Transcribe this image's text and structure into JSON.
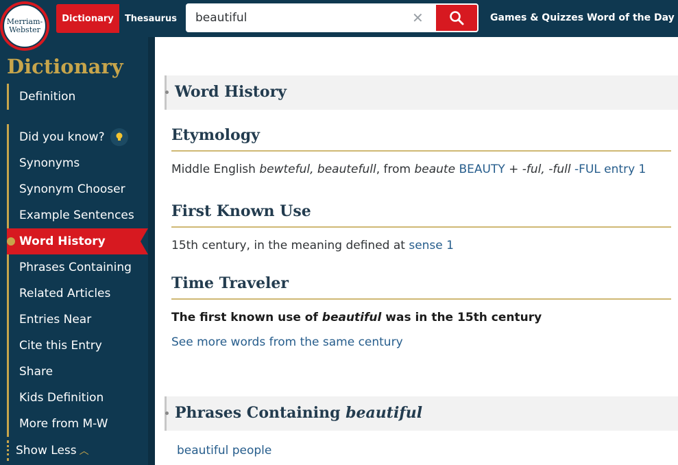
{
  "header": {
    "logo_line1": "Merriam-",
    "logo_line2": "Webster",
    "tab_dictionary": "Dictionary",
    "tab_thesaurus": "Thesaurus",
    "search_value": "beautiful",
    "nav_games": "Games & Quizzes",
    "nav_wotd": "Word of the Day",
    "colors": {
      "navy": "#0f3850",
      "red": "#d71920",
      "gold": "#c7a54b"
    }
  },
  "sidebar": {
    "title": "Dictionary",
    "items": [
      "Definition",
      "Did you know?",
      "Synonyms",
      "Synonym Chooser",
      "Example Sentences",
      "Word History",
      "Phrases Containing",
      "Related Articles",
      "Entries Near",
      "Cite this Entry",
      "Share",
      "Kids Definition",
      "More from M-W"
    ],
    "active": "Word History",
    "show_less": "Show Less"
  },
  "main": {
    "word_history": {
      "title": "Word History",
      "etymology": {
        "heading": "Etymology",
        "t1": "Middle English ",
        "t2": "bewteful, beautefull",
        "t3": ", from ",
        "t4": "beaute",
        "t5": " ",
        "link1": "BEAUTY",
        "t6": " + ",
        "t7": "-ful, -full",
        "t8": " ",
        "link2": "-FUL entry 1"
      },
      "first_known_use": {
        "heading": "First Known Use",
        "text": "15th century, in the meaning defined at ",
        "link": "sense 1"
      },
      "time_traveler": {
        "heading": "Time Traveler",
        "b1": "The first known use of ",
        "b2": "beautiful",
        "b3": " was in the 15th century",
        "link": "See more words from the same century"
      }
    },
    "phrases": {
      "title_prefix": "Phrases Containing ",
      "title_word": "beautiful",
      "items": [
        "beautiful people"
      ]
    }
  }
}
